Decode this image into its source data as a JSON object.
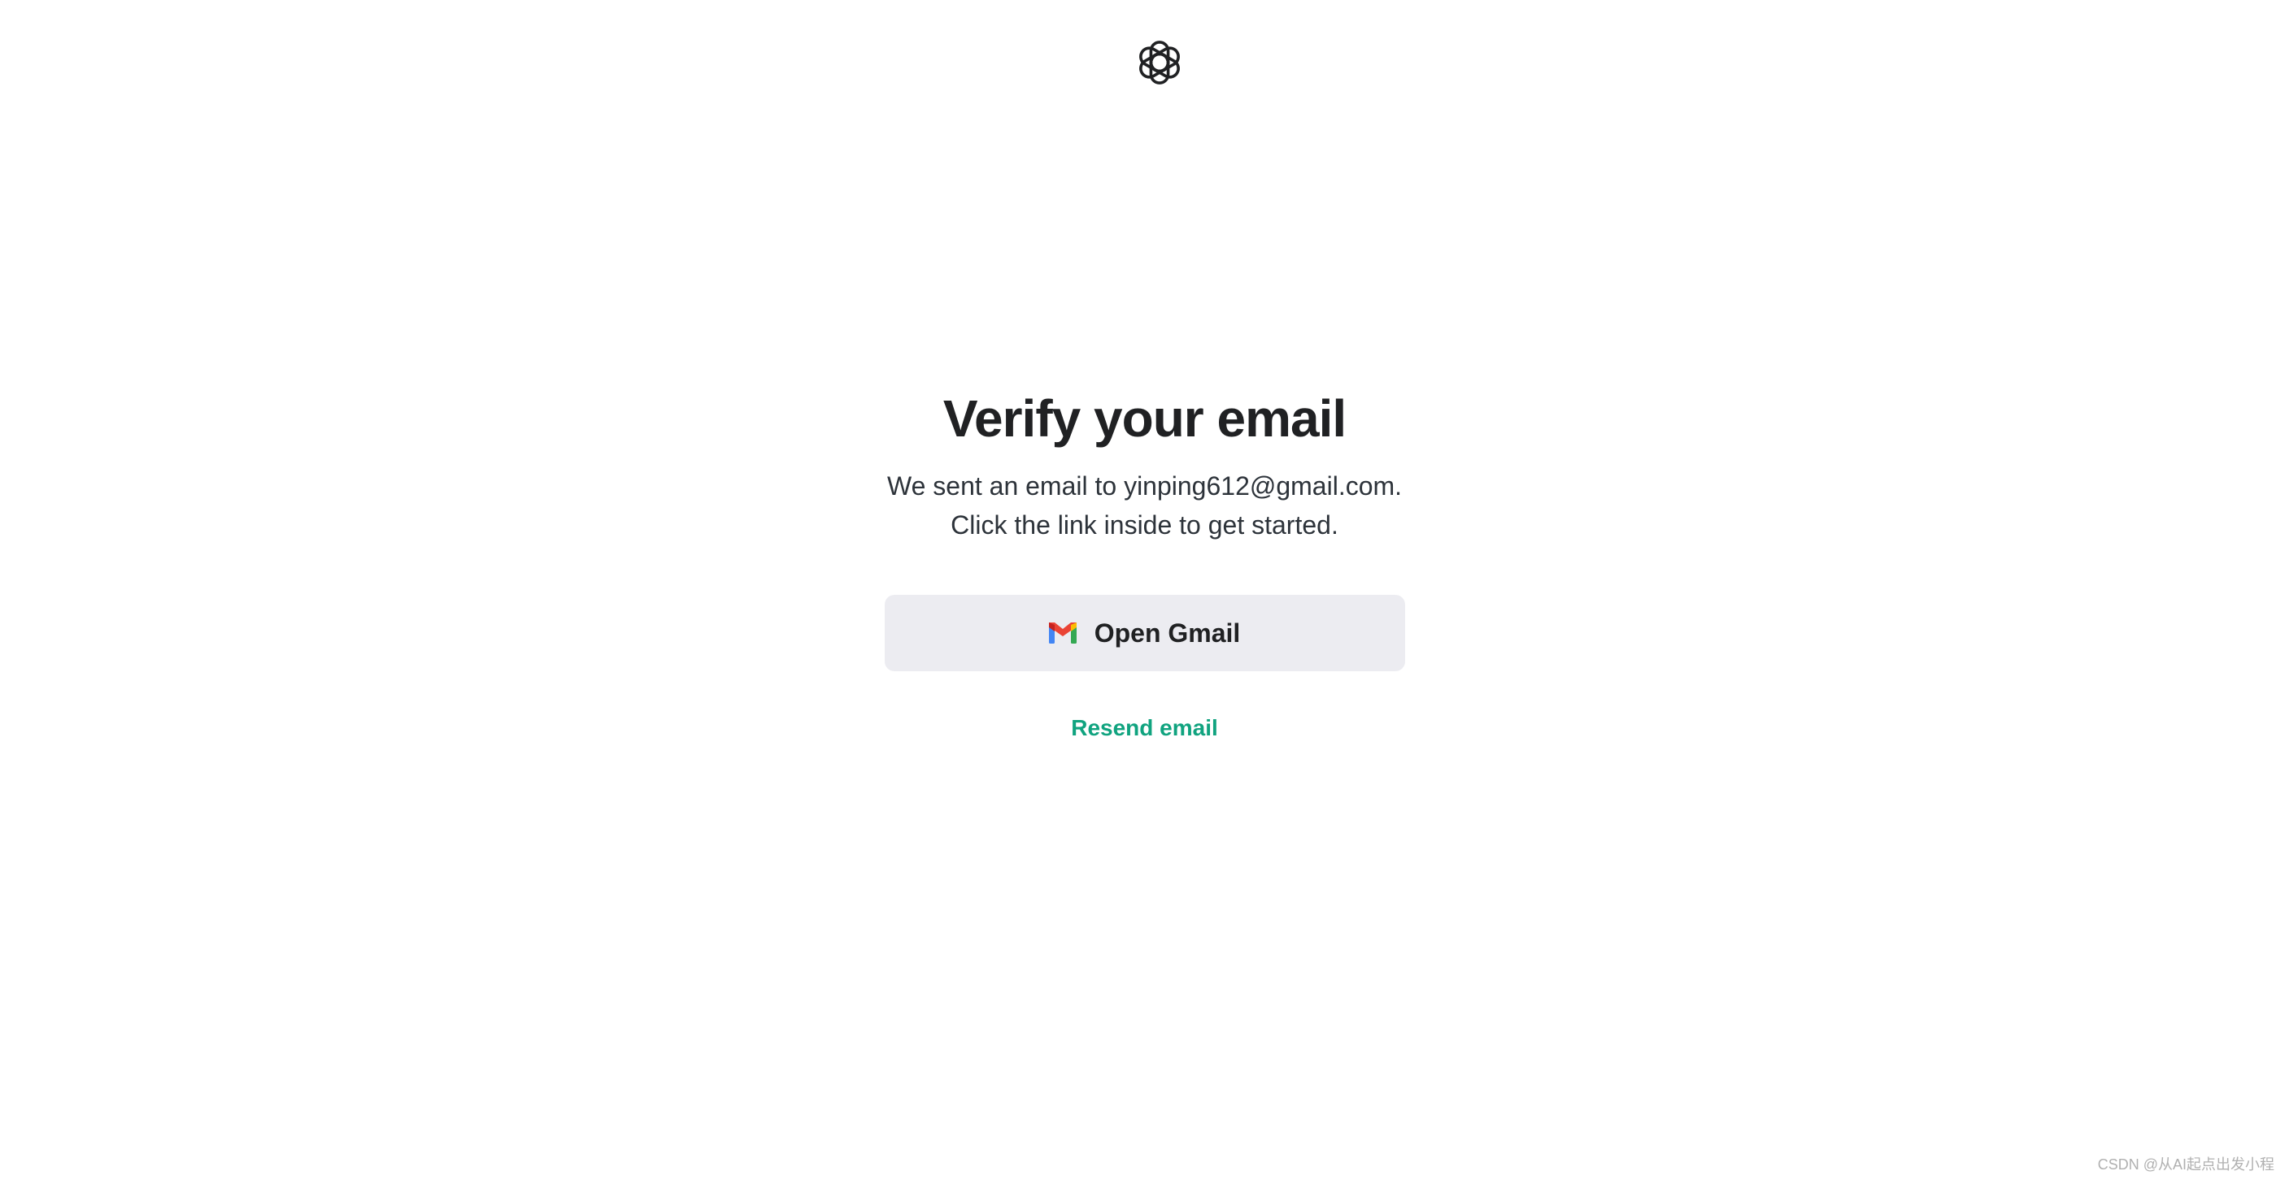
{
  "logo": {
    "icon": "openai-logo-icon"
  },
  "verify": {
    "title": "Verify your email",
    "line1": "We sent an email to yinping612@gmail.com.",
    "line2": "Click the link inside to get started."
  },
  "actions": {
    "open_gmail_label": "Open Gmail",
    "gmail_icon": "gmail-icon",
    "resend_label": "Resend email"
  },
  "watermark": {
    "text": "CSDN @从AI起点出发小程"
  },
  "colors": {
    "background": "#ffffff",
    "button_bg": "#ececf1",
    "link": "#10a37f",
    "text": "#202123"
  }
}
